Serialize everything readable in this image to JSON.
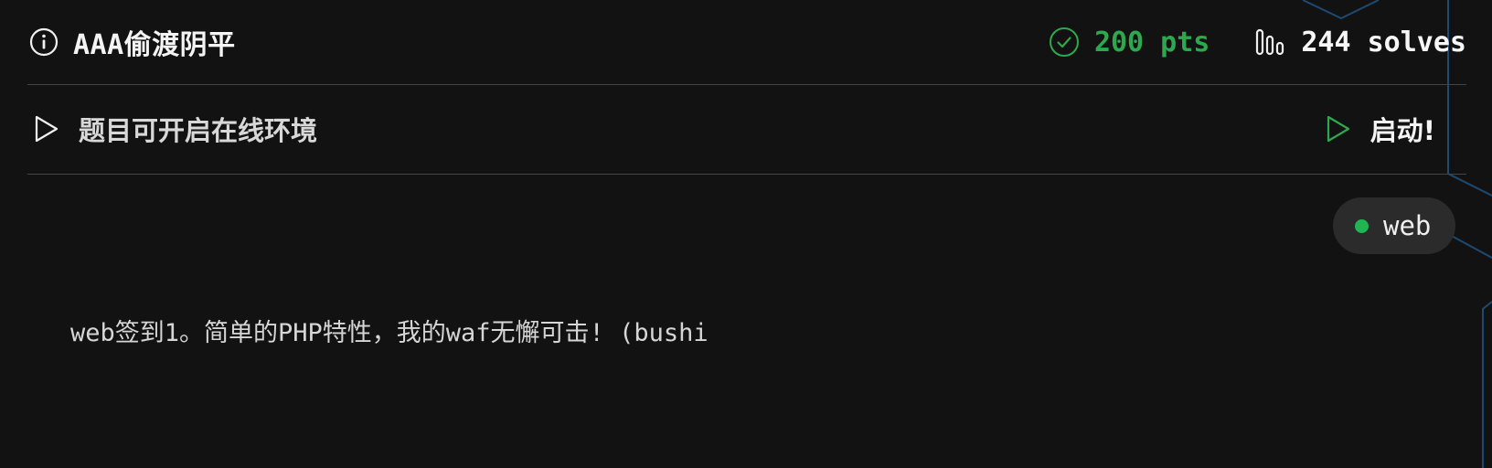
{
  "challenge": {
    "title": "AAA偷渡阴平",
    "points": "200 pts",
    "solves": "244 solves"
  },
  "environment": {
    "label": "题目可开启在线环境",
    "start_label": "启动!"
  },
  "tag": {
    "label": "web"
  },
  "description": "web签到1。简单的PHP特性，我的waf无懈可击! (bushi",
  "colors": {
    "background": "#121212",
    "accent_green": "#2ea84f",
    "tag_dot": "#20b552",
    "tag_bg": "#2b2b2b",
    "divider": "#444444",
    "deco_line": "#1d4a72"
  },
  "icons": {
    "title_icon": "info-icon",
    "points_icon": "check-circle-icon",
    "solves_icon": "bar-chart-icon",
    "env_icon": "play-outline-icon",
    "start_icon": "play-green-icon"
  }
}
